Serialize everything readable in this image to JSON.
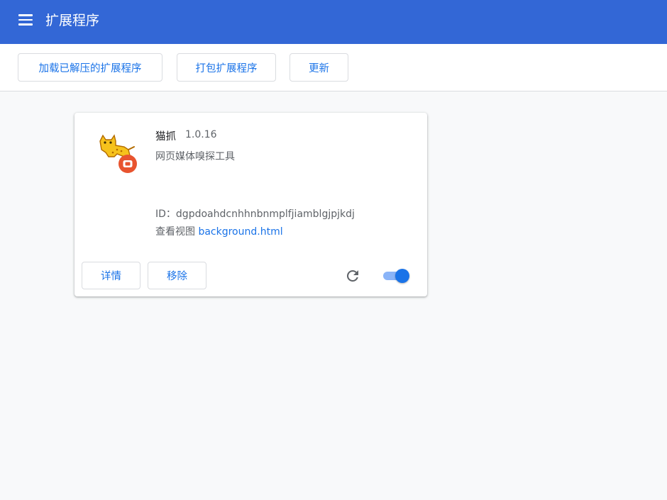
{
  "header": {
    "title": "扩展程序",
    "menu_icon": "hamburger-menu-icon",
    "color": "#3367d6"
  },
  "toolbar": {
    "load_unpacked_label": "加载已解压的扩展程序",
    "pack_label": "打包扩展程序",
    "update_label": "更新"
  },
  "extension": {
    "name": "猫抓",
    "version": "1.0.16",
    "description": "网页媒体嗅探工具",
    "id_label": "ID：",
    "id_value": "dgpdoahdcnhhnbnmplfjiamblgjpjkdj",
    "views_label": "查看视图",
    "views_link": "background.html",
    "icon": "cat-catch-icon",
    "details_label": "详情",
    "remove_label": "移除",
    "reload_icon": "reload-icon",
    "enabled": true,
    "accent_color": "#1a73e8"
  }
}
